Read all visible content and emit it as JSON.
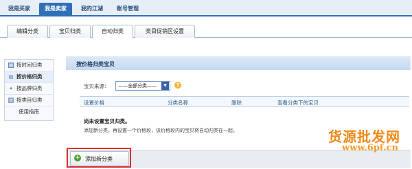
{
  "topnav": {
    "items": [
      {
        "label": "我是买家"
      },
      {
        "label": "我是卖家"
      },
      {
        "label": "我的江湖"
      },
      {
        "label": "账号管理"
      }
    ]
  },
  "subtabs": {
    "items": [
      {
        "label": "编辑分类"
      },
      {
        "label": "宝贝归类"
      },
      {
        "label": "自动归类"
      },
      {
        "label": "类目促销区设置"
      }
    ]
  },
  "sidebar": {
    "items": [
      {
        "label": "按时间归类",
        "icon": "calendar-icon"
      },
      {
        "label": "按价格归类",
        "icon": "price-icon"
      },
      {
        "label": "按品牌归类",
        "icon": "brand-icon"
      },
      {
        "label": "按类目归类",
        "icon": "category-icon"
      },
      {
        "label": "使用指南"
      }
    ]
  },
  "panel": {
    "title": "按价格归类宝贝",
    "source_label": "宝贝来源：",
    "source_value": "——全部分类——",
    "help_icon": "help-icon",
    "columns": [
      "设置价格",
      "分类名称",
      "删除",
      "查看分类下的宝贝"
    ],
    "empty_title": "尚未设置宝贝归类。",
    "empty_desc": "添加新分类，再设置一个价格段，该价格段内的宝贝将自动归类在一起。",
    "add_button": "添加新分类"
  },
  "watermark": {
    "line1": "货源批发网",
    "line2": "www.6pf.cn"
  },
  "colors": {
    "nav_active": "#2f6fb8",
    "panel_header": "#c6daf2",
    "highlight": "#e0312b",
    "watermark": "#f08a18"
  }
}
